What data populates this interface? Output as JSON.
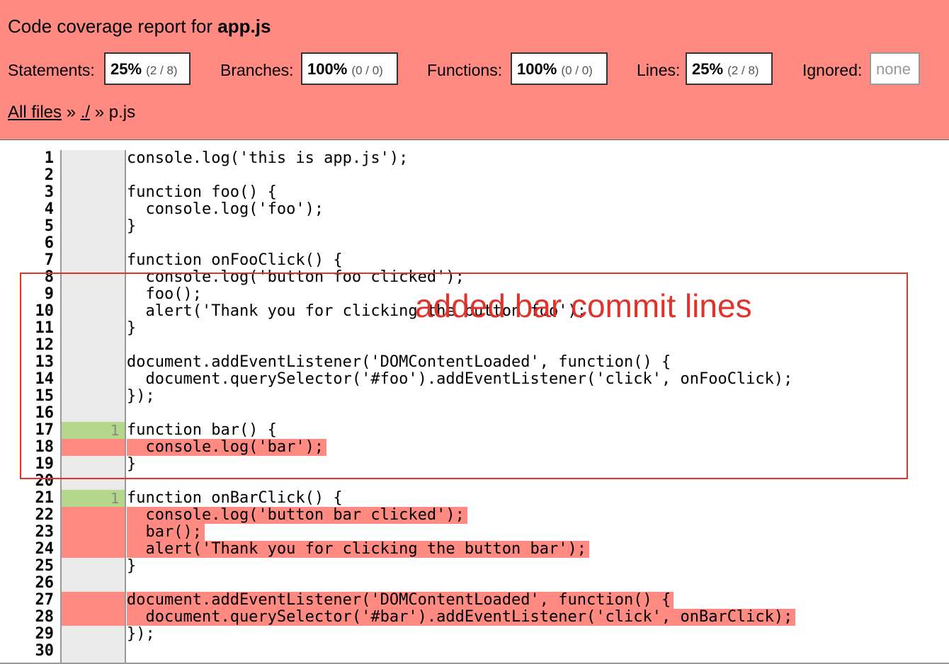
{
  "header": {
    "title_prefix": "Code coverage report for",
    "title_file": "app.js",
    "stats": {
      "statements": {
        "label": "Statements:",
        "pct": "25%",
        "frac": "(2 / 8)"
      },
      "branches": {
        "label": "Branches:",
        "pct": "100%",
        "frac": "(0 / 0)"
      },
      "functions": {
        "label": "Functions:",
        "pct": "100%",
        "frac": "(0 / 0)"
      },
      "lines": {
        "label": "Lines:",
        "pct": "25%",
        "frac": "(2 / 8)"
      },
      "ignored": {
        "label": "Ignored:",
        "value": "none"
      }
    },
    "breadcrumb": {
      "all_files": "All files",
      "sep1": "»",
      "dir": "./",
      "sep2": "»",
      "file": "p.js"
    }
  },
  "colors": {
    "header_bg": "#fe8a82",
    "covered": "#b4d78c",
    "uncovered": "#fe8a82",
    "annotation": "#e0332b"
  },
  "code": {
    "lines": [
      {
        "n": "1",
        "text": "console.log('this is app.js');",
        "count": "",
        "cov": "none",
        "hl": false
      },
      {
        "n": "2",
        "text": "",
        "count": "",
        "cov": "none",
        "hl": false
      },
      {
        "n": "3",
        "text": "function foo() {",
        "count": "",
        "cov": "none",
        "hl": false
      },
      {
        "n": "4",
        "text": "  console.log('foo');",
        "count": "",
        "cov": "none",
        "hl": false
      },
      {
        "n": "5",
        "text": "}",
        "count": "",
        "cov": "none",
        "hl": false
      },
      {
        "n": "6",
        "text": "",
        "count": "",
        "cov": "none",
        "hl": false
      },
      {
        "n": "7",
        "text": "function onFooClick() {",
        "count": "",
        "cov": "none",
        "hl": false
      },
      {
        "n": "8",
        "text": "  console.log('button foo clicked');",
        "count": "",
        "cov": "none",
        "hl": false
      },
      {
        "n": "9",
        "text": "  foo();",
        "count": "",
        "cov": "none",
        "hl": false
      },
      {
        "n": "10",
        "text": "  alert('Thank you for clicking the button foo');",
        "count": "",
        "cov": "none",
        "hl": false
      },
      {
        "n": "11",
        "text": "}",
        "count": "",
        "cov": "none",
        "hl": false
      },
      {
        "n": "12",
        "text": "",
        "count": "",
        "cov": "none",
        "hl": false
      },
      {
        "n": "13",
        "text": "document.addEventListener('DOMContentLoaded', function() {",
        "count": "",
        "cov": "none",
        "hl": false
      },
      {
        "n": "14",
        "text": "  document.querySelector('#foo').addEventListener('click', onFooClick);",
        "count": "",
        "cov": "none",
        "hl": false
      },
      {
        "n": "15",
        "text": "});",
        "count": "",
        "cov": "none",
        "hl": false
      },
      {
        "n": "16",
        "text": "",
        "count": "",
        "cov": "none",
        "hl": false
      },
      {
        "n": "17",
        "text": "function bar() {",
        "count": "1",
        "cov": "hit",
        "hl": false
      },
      {
        "n": "18",
        "text": "  console.log('bar');",
        "count": "",
        "cov": "miss",
        "hl": true
      },
      {
        "n": "19",
        "text": "}",
        "count": "",
        "cov": "none",
        "hl": false
      },
      {
        "n": "20",
        "text": "",
        "count": "",
        "cov": "none",
        "hl": false
      },
      {
        "n": "21",
        "text": "function onBarClick() {",
        "count": "1",
        "cov": "hit",
        "hl": false
      },
      {
        "n": "22",
        "text": "  console.log('button bar clicked');",
        "count": "",
        "cov": "miss",
        "hl": true
      },
      {
        "n": "23",
        "text": "  bar();",
        "count": "",
        "cov": "miss",
        "hl": true
      },
      {
        "n": "24",
        "text": "  alert('Thank you for clicking the button bar');",
        "count": "",
        "cov": "miss",
        "hl": true
      },
      {
        "n": "25",
        "text": "}",
        "count": "",
        "cov": "none",
        "hl": false
      },
      {
        "n": "26",
        "text": "",
        "count": "",
        "cov": "none",
        "hl": false
      },
      {
        "n": "27",
        "text": "document.addEventListener('DOMContentLoaded', function() {",
        "count": "",
        "cov": "miss",
        "hl": true
      },
      {
        "n": "28",
        "text": "  document.querySelector('#bar').addEventListener('click', onBarClick);",
        "count": "",
        "cov": "miss",
        "hl": true
      },
      {
        "n": "29",
        "text": "});",
        "count": "",
        "cov": "none",
        "hl": false
      },
      {
        "n": "30",
        "text": "",
        "count": "",
        "cov": "none",
        "hl": false
      }
    ]
  },
  "annotation": {
    "text": "added bar commit lines"
  }
}
